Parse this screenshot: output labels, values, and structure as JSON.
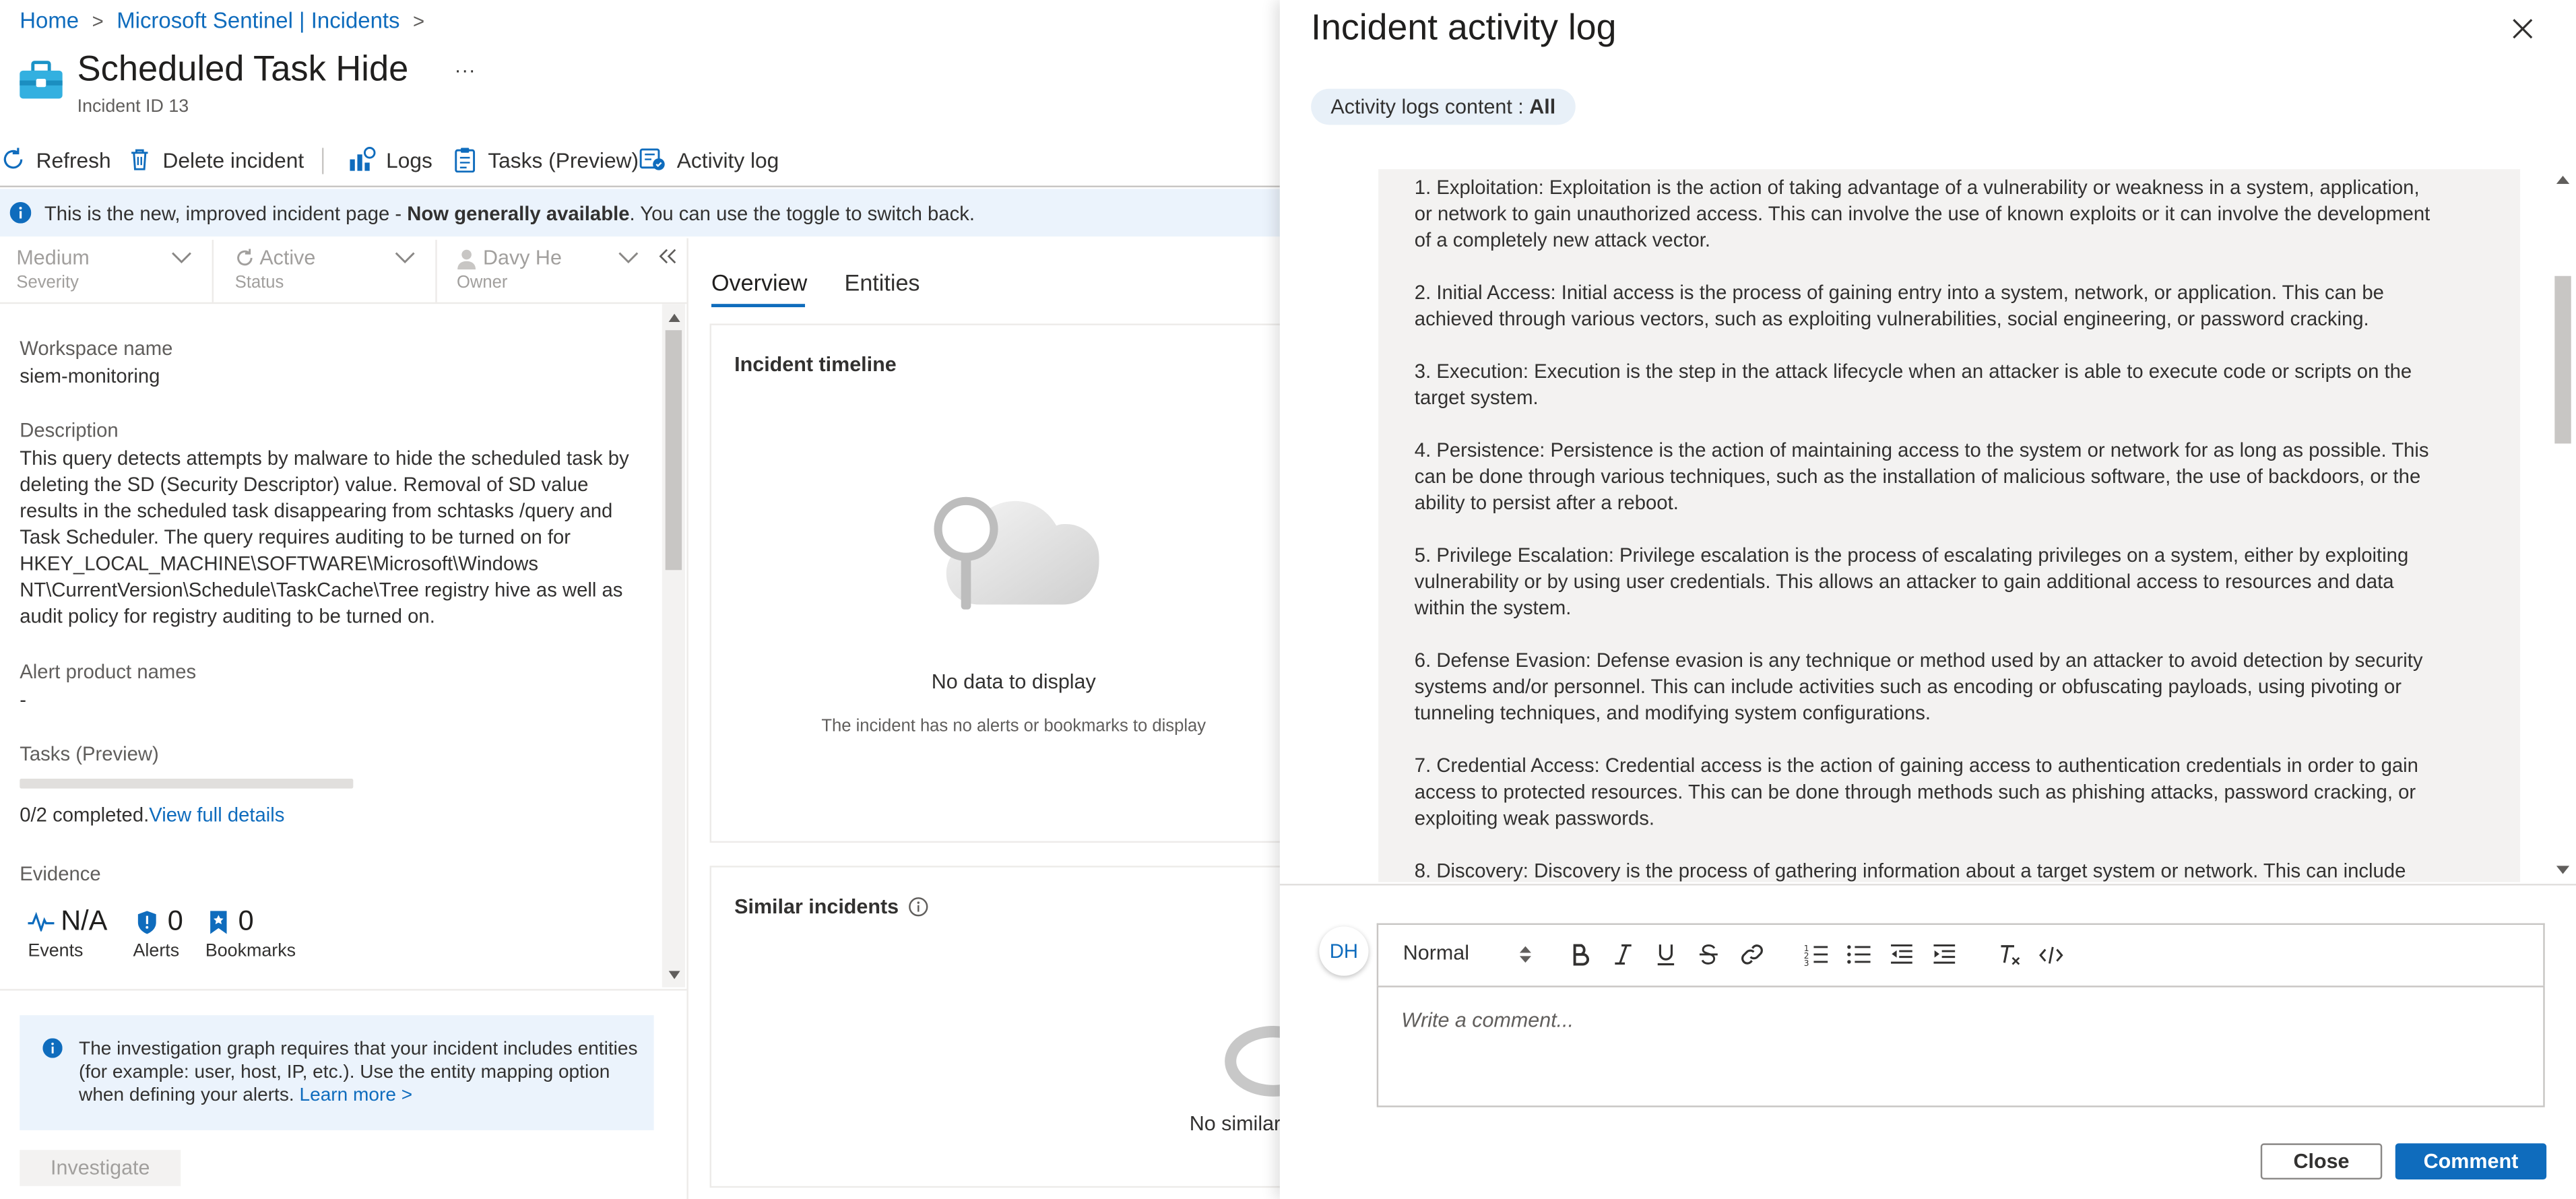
{
  "breadcrumb": {
    "home": "Home",
    "incidents": "Microsoft Sentinel | Incidents",
    "separator": ">"
  },
  "incident": {
    "title": "Scheduled Task Hide",
    "more": "...",
    "id_text": "Incident ID 13"
  },
  "toolbar": {
    "refresh": "Refresh",
    "delete": "Delete incident",
    "logs": "Logs",
    "tasks": "Tasks (Preview)",
    "activity_log": "Activity log"
  },
  "banner": {
    "text_pre": "This is the new, improved incident page - ",
    "text_bold": "Now generally available",
    "text_post": ". You can use the toggle to switch back."
  },
  "meta": {
    "severity": {
      "value": "Medium",
      "label": "Severity"
    },
    "status": {
      "value": "Active",
      "label": "Status"
    },
    "owner": {
      "value": "Davy He",
      "label": "Owner"
    }
  },
  "details": {
    "workspace_label": "Workspace name",
    "workspace_value": "siem-monitoring",
    "description_label": "Description",
    "description_lines": [
      "This query detects attempts by malware to hide the scheduled task by",
      "deleting the SD (Security Descriptor) value. Removal of SD value",
      "results in the scheduled task disappearing from schtasks /query and",
      "Task Scheduler. The query requires auditing to be turned on for",
      "HKEY_LOCAL_MACHINE\\SOFTWARE\\Microsoft\\Windows",
      "NT\\CurrentVersion\\Schedule\\TaskCache\\Tree registry hive as well as",
      "audit policy for registry auditing to be turned on."
    ],
    "alert_products_label": "Alert product names",
    "alert_products_value": "-",
    "tasks_label": "Tasks (Preview)",
    "tasks_progress": 0,
    "tasks_completed": "0/2 completed.",
    "tasks_link": "View full details",
    "evidence_label": "Evidence",
    "evidence": [
      {
        "value": "N/A",
        "label": "Events"
      },
      {
        "value": "0",
        "label": "Alerts"
      },
      {
        "value": "0",
        "label": "Bookmarks"
      }
    ]
  },
  "info_box": {
    "lines": [
      "The investigation graph requires that your incident includes entities",
      "(for example: user, host, IP, etc.). Use the entity mapping option",
      "when defining your alerts."
    ],
    "link": "Learn more >"
  },
  "investigate_button": "Investigate",
  "tabs": [
    {
      "label": "Overview",
      "selected": true
    },
    {
      "label": "Entities",
      "selected": false
    }
  ],
  "timeline": {
    "title": "Incident timeline",
    "empty_title": "No data to display",
    "empty_sub": "The incident has no alerts or bookmarks to display"
  },
  "similar": {
    "title": "Similar incidents",
    "empty_text": "No similar"
  },
  "panel": {
    "title": "Incident activity log",
    "filter_label": "Activity logs content : ",
    "filter_value": "All",
    "log_items": [
      [
        "1. Exploitation: Exploitation is the action of taking advantage of a vulnerability or weakness in a system, application,",
        "or network to gain unauthorized access. This can involve the use of known exploits or it can involve the development",
        "of a completely new attack vector."
      ],
      [
        "2. Initial Access: Initial access is the process of gaining entry into a system, network, or application. This can be",
        "achieved through various vectors, such as exploiting vulnerabilities, social engineering, or password cracking."
      ],
      [
        "3. Execution: Execution is the step in the attack lifecycle when an attacker is able to execute code or scripts on the",
        "target system."
      ],
      [
        "4. Persistence: Persistence is the action of maintaining access to the system or network for as long as possible. This",
        "can be done through various techniques, such as the installation of malicious software, the use of backdoors, or the",
        "ability to persist after a reboot."
      ],
      [
        "5. Privilege Escalation: Privilege escalation is the process of escalating privileges on a system, either by exploiting",
        "vulnerability or by using user credentials. This allows an attacker to gain additional access to resources and data",
        "within the system."
      ],
      [
        "6. Defense Evasion: Defense evasion is any technique or method used by an attacker to avoid detection by security",
        "systems and/or personnel. This can include activities such as encoding or obfuscating payloads, using pivoting or",
        "tunneling techniques, and modifying system configurations."
      ],
      [
        "7. Credential Access: Credential access is the action of gaining access to authentication credentials in order to gain",
        "access to protected resources. This can be done through methods such as phishing attacks, password cracking, or",
        "exploiting weak passwords."
      ],
      [
        "8. Discovery: Discovery is the process of gathering information about a target system or network. This can include"
      ]
    ],
    "avatar": "DH",
    "format_select": "Normal",
    "comment_placeholder": "Write a comment...",
    "close_button": "Close",
    "comment_button": "Comment"
  },
  "colors": {
    "accent": "#0f6cbd",
    "banner_bg": "#ebf3fc",
    "log_bg": "#f3f2f1",
    "filter_pill_bg": "#e8f0f8"
  }
}
